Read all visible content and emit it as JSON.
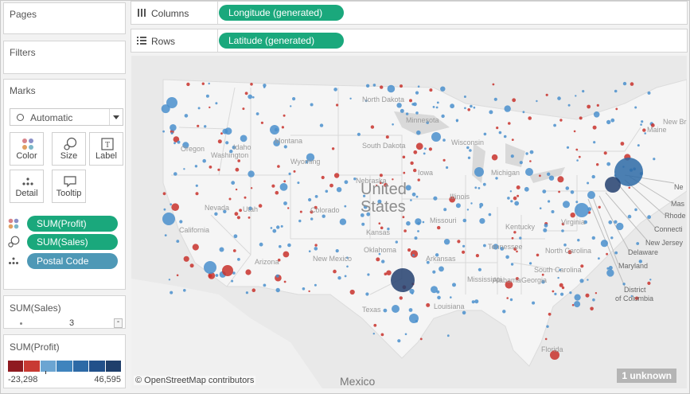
{
  "left_panel": {
    "pages_title": "Pages",
    "filters_title": "Filters",
    "marks": {
      "title": "Marks",
      "mark_type": "Automatic",
      "buttons": {
        "color": "Color",
        "size": "Size",
        "label": "Label",
        "detail": "Detail",
        "tooltip": "Tooltip"
      },
      "fields": [
        {
          "icon": "color-icon",
          "label": "SUM(Profit)",
          "color": "#1aa87c"
        },
        {
          "icon": "size-icon",
          "label": "SUM(Sales)",
          "color": "#1aa87c"
        },
        {
          "icon": "detail-icon",
          "label": "Postal Code",
          "color": "#4e98b6"
        }
      ]
    },
    "size_legend": {
      "title": "SUM(Sales)",
      "value": "3"
    },
    "color_legend": {
      "title": "SUM(Profit)",
      "min_label": "-23,298",
      "max_label": "46,595",
      "colors": [
        "#8f1a20",
        "#c83a33",
        "#6ba5d2",
        "#3f84bd",
        "#2d6aa6",
        "#22508a",
        "#1f3f6b"
      ]
    }
  },
  "shelves": {
    "columns_label": "Columns",
    "columns_pill": "Longitude (generated)",
    "rows_label": "Rows",
    "rows_pill": "Latitude (generated)"
  },
  "map": {
    "country_label_1": "United",
    "country_label_2": "States",
    "mexico_label": "Mexico",
    "states": [
      "Washington",
      "Oregon",
      "Idaho",
      "Montana",
      "North Dakota",
      "South Dakota",
      "Minnesota",
      "Wisconsin",
      "Wyoming",
      "Nevada",
      "Utah",
      "Colorado",
      "Nebraska",
      "Iowa",
      "Illinois",
      "Kansas",
      "Missouri",
      "California",
      "Arizona",
      "New Mexico",
      "Oklahoma",
      "Arkansas",
      "Texas",
      "Louisiana",
      "Mississippi",
      "Alabama",
      "Georgia",
      "Tennessee",
      "Kentucky",
      "South Carolina",
      "North Carolina",
      "Virginia",
      "Florida",
      "Maine",
      "New Brunswick",
      "Michigan"
    ],
    "callouts": [
      "New Jersey",
      "Delaware",
      "Maryland",
      "District of Columbia",
      "Massachusetts",
      "Rhode Island",
      "Connecticut"
    ],
    "callout_visible": [
      "Ne",
      "Mas",
      "Rhode",
      "Connecti",
      "New Jersey",
      "Delaware",
      "Maryland",
      "District",
      "of Columbia"
    ],
    "attribution": "© OpenStreetMap contributors",
    "unknown_badge": "1 unknown",
    "colors": {
      "profit_negative": "#c8312c",
      "profit_positive": "#4a8fcc",
      "profit_high": "#23406e"
    }
  }
}
